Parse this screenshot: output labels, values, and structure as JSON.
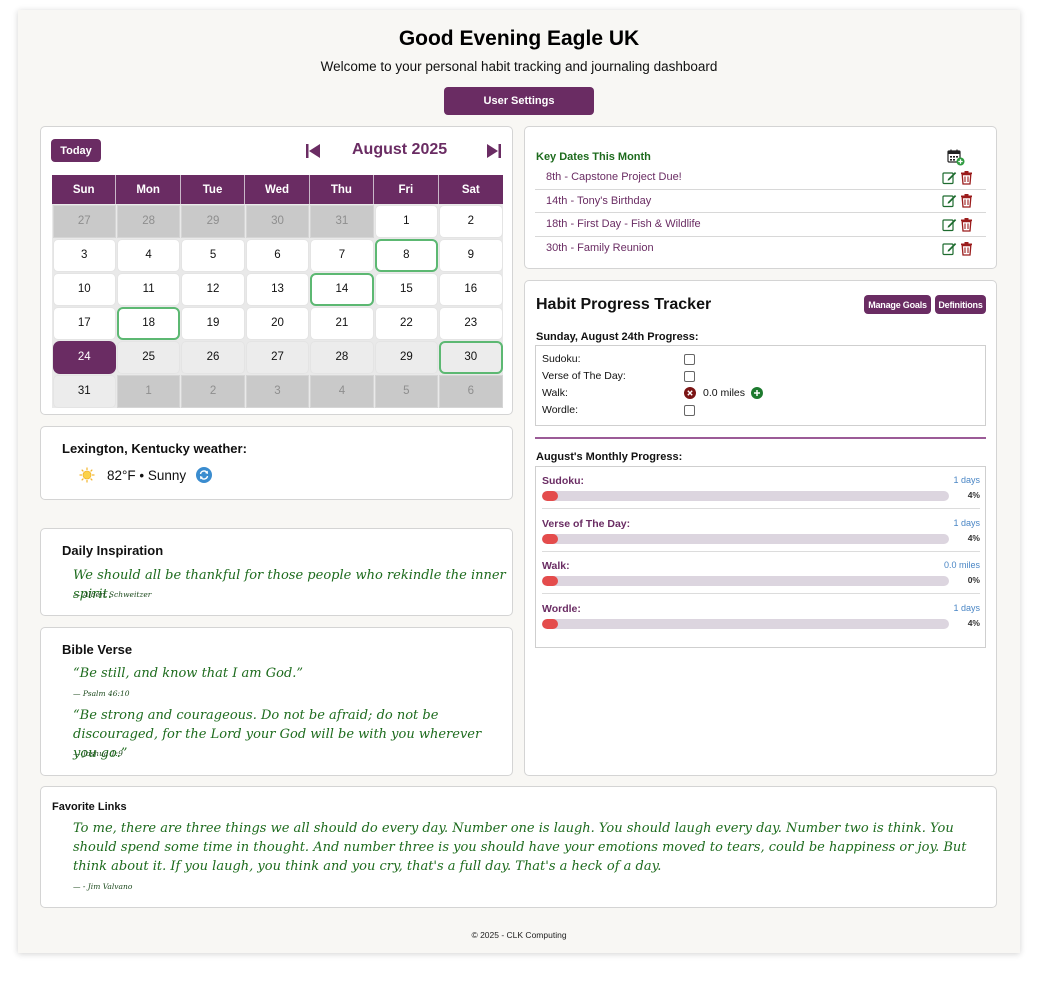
{
  "header": {
    "greeting": "Good Evening Eagle UK",
    "subtitle": "Welcome to your personal habit tracking and journaling dashboard",
    "settings_label": "User Settings"
  },
  "calendar": {
    "today_label": "Today",
    "month_label": "August 2025",
    "weekdays": [
      "Sun",
      "Mon",
      "Tue",
      "Wed",
      "Thu",
      "Fri",
      "Sat"
    ],
    "days": [
      {
        "d": "27",
        "t": "other"
      },
      {
        "d": "28",
        "t": "other"
      },
      {
        "d": "29",
        "t": "other"
      },
      {
        "d": "30",
        "t": "other"
      },
      {
        "d": "31",
        "t": "other"
      },
      {
        "d": "1",
        "t": ""
      },
      {
        "d": "2",
        "t": ""
      },
      {
        "d": "3",
        "t": ""
      },
      {
        "d": "4",
        "t": ""
      },
      {
        "d": "5",
        "t": ""
      },
      {
        "d": "6",
        "t": ""
      },
      {
        "d": "7",
        "t": ""
      },
      {
        "d": "8",
        "t": "key"
      },
      {
        "d": "9",
        "t": ""
      },
      {
        "d": "10",
        "t": ""
      },
      {
        "d": "11",
        "t": ""
      },
      {
        "d": "12",
        "t": ""
      },
      {
        "d": "13",
        "t": ""
      },
      {
        "d": "14",
        "t": "key"
      },
      {
        "d": "15",
        "t": ""
      },
      {
        "d": "16",
        "t": ""
      },
      {
        "d": "17",
        "t": ""
      },
      {
        "d": "18",
        "t": "key"
      },
      {
        "d": "19",
        "t": ""
      },
      {
        "d": "20",
        "t": ""
      },
      {
        "d": "21",
        "t": ""
      },
      {
        "d": "22",
        "t": ""
      },
      {
        "d": "23",
        "t": ""
      },
      {
        "d": "24",
        "t": "today"
      },
      {
        "d": "25",
        "t": "future"
      },
      {
        "d": "26",
        "t": "future"
      },
      {
        "d": "27",
        "t": "future"
      },
      {
        "d": "28",
        "t": "future"
      },
      {
        "d": "29",
        "t": "future"
      },
      {
        "d": "30",
        "t": "key future"
      },
      {
        "d": "31",
        "t": "future"
      },
      {
        "d": "1",
        "t": "other"
      },
      {
        "d": "2",
        "t": "other"
      },
      {
        "d": "3",
        "t": "other"
      },
      {
        "d": "4",
        "t": "other"
      },
      {
        "d": "5",
        "t": "other"
      },
      {
        "d": "6",
        "t": "other"
      }
    ]
  },
  "weather": {
    "title": "Lexington, Kentucky weather:",
    "summary": "82°F • Sunny"
  },
  "inspiration": {
    "title": "Daily Inspiration",
    "quote": "We should all be thankful for those people who rekindle the inner spirit.",
    "author": "— Albert Schweitzer"
  },
  "bible": {
    "title": "Bible Verse",
    "verse1": "“Be still, and know that I am God.”",
    "ref1": "— Psalm 46:10",
    "verse2": "“Be strong and courageous. Do not be afraid; do not be discouraged, for the Lord your God will be with you wherever you go.”",
    "ref2": "— Joshua 1:9"
  },
  "key_dates": {
    "title": "Key Dates This Month",
    "items": [
      "8th - Capstone Project Due!",
      "14th - Tony's Birthday",
      "18th - First Day - Fish & Wildlife",
      "30th - Family Reunion"
    ]
  },
  "habits": {
    "title": "Habit Progress Tracker",
    "manage_label": "Manage Goals",
    "definitions_label": "Definitions",
    "daily_title": "Sunday, August 24th Progress:",
    "daily": {
      "sudoku": "Sudoku:",
      "verse": "Verse of The Day:",
      "walk": "Walk:",
      "walk_value": "0.0 miles",
      "wordle": "Wordle:"
    },
    "monthly_title": "August's Monthly Progress:",
    "monthly": [
      {
        "name": "Sudoku:",
        "days": "1 days",
        "pct_label": "4%",
        "pct": 4
      },
      {
        "name": "Verse of The Day:",
        "days": "1 days",
        "pct_label": "4%",
        "pct": 4
      },
      {
        "name": "Walk:",
        "days": "0.0 miles",
        "pct_label": "0%",
        "pct": 0
      },
      {
        "name": "Wordle:",
        "days": "1 days",
        "pct_label": "4%",
        "pct": 4
      }
    ]
  },
  "favorites": {
    "title": "Favorite Links",
    "quote": "To me, there are three things we all should do every day. Number one is laugh. You should laugh every day. Number two is think. You should spend some time in thought. And number three is you should have your emotions moved to tears, could be happiness or joy. But think about it. If you laugh, you think and you cry, that's a full day. That's a heck of a day.",
    "author": "— - Jim Valvano"
  },
  "footer": "© 2025 - CLK Computing",
  "colors": {
    "brand": "#6a2c63",
    "key_date_outline": "#5cb872",
    "quote_green": "#1d6b1d",
    "progress_fill": "#e44c4c",
    "progress_track": "#dcd5df"
  }
}
